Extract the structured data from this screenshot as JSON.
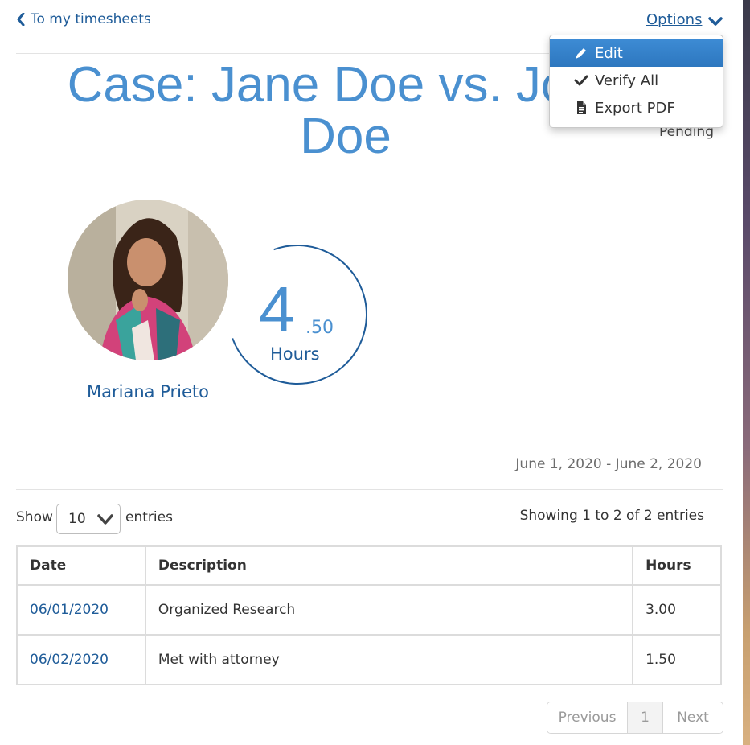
{
  "nav": {
    "back_label": "To my timesheets",
    "options_label": "Options"
  },
  "options_menu": {
    "items": [
      {
        "label": "Edit",
        "icon": "pencil-icon",
        "active": true
      },
      {
        "label": "Verify All",
        "icon": "check-icon",
        "active": false
      },
      {
        "label": "Export PDF",
        "icon": "document-icon",
        "active": false
      }
    ]
  },
  "timesheet": {
    "title": "Case: Jane Doe vs. John Doe",
    "status": "Pending",
    "person_name": "Mariana Prieto",
    "hours_whole": "4",
    "hours_fraction": ".50",
    "hours_label": "Hours",
    "date_range": "June 1, 2020 - June 2, 2020"
  },
  "table_controls": {
    "show_label": "Show",
    "page_size": "10",
    "entries_label": "entries",
    "showing_info": "Showing 1 to 2 of 2 entries"
  },
  "table": {
    "headers": [
      "Date",
      "Description",
      "Hours"
    ],
    "rows": [
      {
        "date": "06/01/2020",
        "description": "Organized Research",
        "hours": "3.00"
      },
      {
        "date": "06/02/2020",
        "description": "Met with attorney",
        "hours": "1.50"
      }
    ]
  },
  "pagination": {
    "previous_label": "Previous",
    "current_page": "1",
    "next_label": "Next"
  },
  "colors": {
    "accent": "#4a90d0",
    "link": "#1f5c99",
    "menu_active": "#2d77bf"
  }
}
